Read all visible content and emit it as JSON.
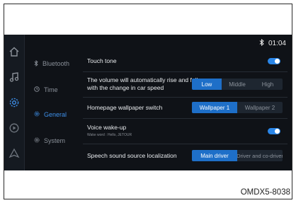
{
  "status_bar": {
    "bluetooth_icon": "bluetooth-icon",
    "time": "01:04"
  },
  "rail": {
    "icons": [
      "home-icon",
      "music-icon",
      "settings-icon",
      "media-icon",
      "navigation-icon"
    ]
  },
  "menu": {
    "items": [
      {
        "label": "Bluetooth",
        "icon": "bluetooth-icon",
        "active": false
      },
      {
        "label": "Time",
        "icon": "clock-icon",
        "active": false
      },
      {
        "label": "General",
        "icon": "gear-icon",
        "active": true
      },
      {
        "label": "System",
        "icon": "gear-icon",
        "active": false
      }
    ]
  },
  "settings": {
    "touch_tone": {
      "label": "Touch tone",
      "enabled": true
    },
    "volume": {
      "label_line1": "The volume will automatically rise and fall",
      "label_line2": "with the change in car speed",
      "options": [
        "Low",
        "Middle",
        "High"
      ],
      "selected": "Low"
    },
    "wallpaper": {
      "label": "Homepage wallpaper switch",
      "options": [
        "Wallpaper 1",
        "Wallpaper 2"
      ],
      "selected": "Wallpaper 1"
    },
    "voice_wakeup": {
      "label": "Voice wake-up",
      "sublabel": "Wake word : Hello, JETOUR",
      "enabled": true
    },
    "speech_source": {
      "label": "Speech sound source localization",
      "options": [
        "Main driver",
        "Driver and co-driver"
      ],
      "selected": "Main driver"
    }
  },
  "caption": "OMDX5-8038",
  "colors": {
    "accent": "#2a86e8",
    "background": "#0f1217",
    "active_menu": "#3e8fe8"
  }
}
